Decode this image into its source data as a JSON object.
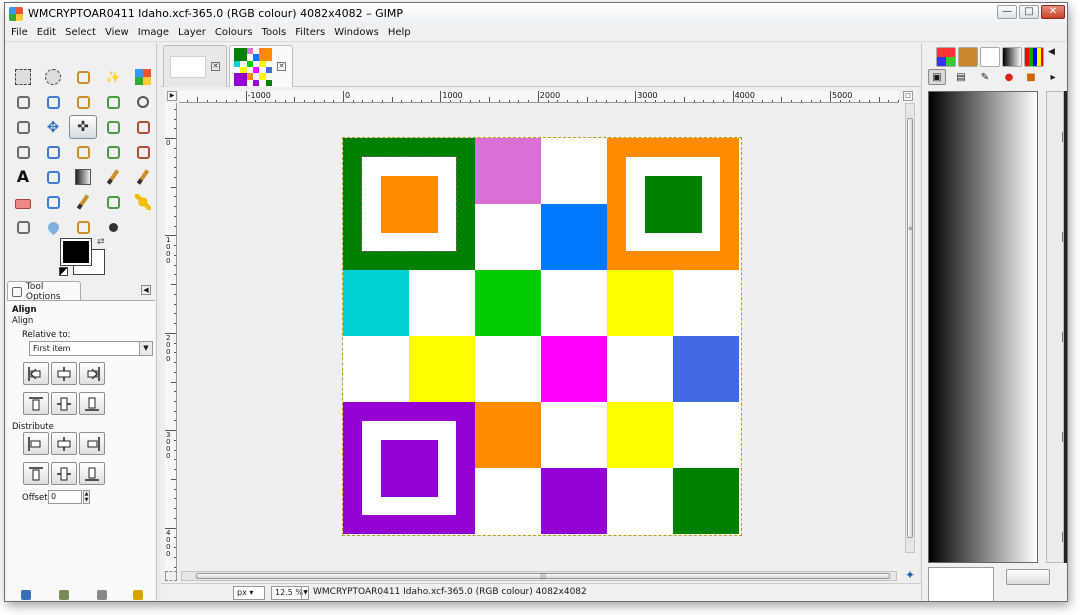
{
  "window": {
    "title": "WMCRYPTOAR0411 Idaho.xcf-365.0 (RGB colour) 4082x4082 – GIMP",
    "buttons": {
      "minimize": "—",
      "maximize": "□",
      "close": "✕"
    }
  },
  "menubar": [
    "File",
    "Edit",
    "Select",
    "View",
    "Image",
    "Layer",
    "Colours",
    "Tools",
    "Filters",
    "Windows",
    "Help"
  ],
  "toolbox": {
    "tools": [
      "rect-select-icon",
      "ellipse-select-icon",
      "free-select-icon",
      "fuzzy-select-icon",
      "select-by-color-icon",
      "scissors-select-icon",
      "foreground-select-icon",
      "paths-icon",
      "color-picker-icon",
      "zoom-icon",
      "measure-icon",
      "move-icon",
      "align-icon",
      "crop-icon",
      "rotate-icon",
      "scale-icon",
      "shear-icon",
      "perspective-icon",
      "flip-icon",
      "cage-icon",
      "text-icon",
      "bucket-fill-icon",
      "blend-icon",
      "pencil-icon",
      "paintbrush-icon",
      "eraser-icon",
      "airbrush-icon",
      "ink-icon",
      "clone-icon",
      "heal-icon",
      "perspective-clone-icon",
      "blur-icon",
      "smudge-icon",
      "dodge-burn-icon"
    ],
    "active_tool": "align-icon",
    "fg_color": "#000000",
    "bg_color": "#ffffff"
  },
  "tool_options": {
    "tab_label": "Tool Options",
    "header": "Align",
    "subheader": "Align",
    "relative_label": "Relative to:",
    "relative_value": "First item",
    "distribute_label": "Distribute",
    "offset_label": "Offset:",
    "offset_value": "0"
  },
  "image_tabs": [
    {
      "name": "blank-image"
    },
    {
      "name": "qr-image"
    }
  ],
  "rulers": {
    "h_labels": [
      "-1000",
      "0",
      "1000",
      "2000",
      "3000",
      "4000",
      "5000"
    ],
    "v_labels": [
      "0",
      "1000",
      "2000",
      "3000",
      "4000"
    ]
  },
  "image": {
    "grid_size": 6,
    "cells": [
      [
        "finder-green",
        "finder-green",
        "#da70d6",
        "#ffffff",
        "finder-orange",
        "finder-orange"
      ],
      [
        "finder-green",
        "finder-green",
        "#ffffff",
        "#0078ff",
        "finder-orange",
        "finder-orange"
      ],
      [
        "#00d0d8",
        "#ffffff",
        "#00cc00",
        "#ffffff",
        "#ffff00",
        "#ffffff"
      ],
      [
        "#ffffff",
        "#ffff00",
        "#ffffff",
        "#ff00ff",
        "#ffffff",
        "#4169e1"
      ],
      [
        "finder-purple",
        "finder-purple",
        "#ff8c00",
        "#ffffff",
        "#ffff00",
        "#ffffff"
      ],
      [
        "finder-purple",
        "finder-purple",
        "#ffffff",
        "#9400d3",
        "#ffffff",
        "#008000"
      ]
    ],
    "finders": [
      {
        "name": "top-left",
        "outer": "#008000",
        "core": "#ff8c00"
      },
      {
        "name": "top-right",
        "outer": "#ff8c00",
        "core": "#008000"
      },
      {
        "name": "bottom-left",
        "outer": "#9400d3",
        "core": "#9400d3"
      }
    ]
  },
  "statusbar": {
    "unit": "px",
    "zoom": "12.5 %",
    "text": "WMCRYPTOAR0411 Idaho.xcf-365.0 (RGB colour) 4082x4082"
  },
  "right_dock": {
    "gradient_start": "#000000",
    "gradient_end": "#ffffff"
  }
}
